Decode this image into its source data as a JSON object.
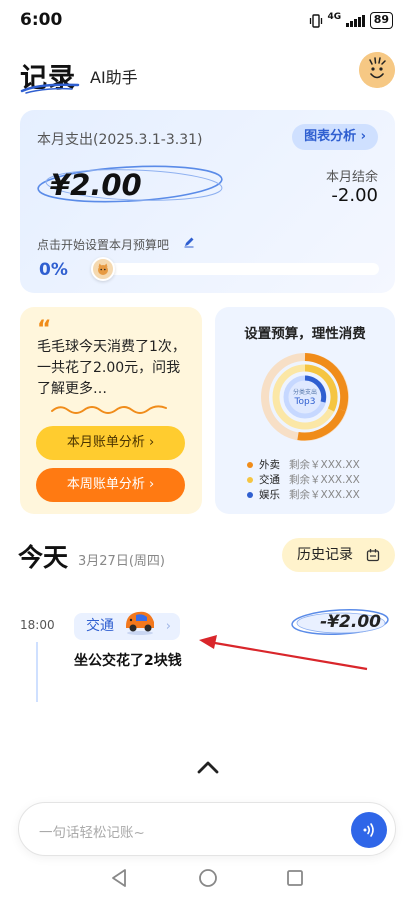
{
  "status": {
    "time": "6:00",
    "network": "4G",
    "battery": "89"
  },
  "header": {
    "tab_records": "记录",
    "tab_ai": "AI助手"
  },
  "summary": {
    "title": "本月支出(2025.3.1-3.31)",
    "chart_button": "图表分析 ›",
    "amount": "¥2.00",
    "balance_label": "本月结余",
    "balance_value": "-2.00",
    "budget_hint": "点击开始设置本月预算吧",
    "budget_percent": "0%",
    "budget_progress": 0
  },
  "mascot": {
    "quote": "“",
    "message": "毛毛球今天消费了1次，一共花了2.00元，问我了解更多…",
    "month_button": "本月账单分析 ›",
    "week_button": "本周账单分析 ›"
  },
  "budget": {
    "title": "设置预算，理性消费",
    "donut_label": "分类支出",
    "donut_center": "Top3",
    "legend": [
      {
        "name": "外卖",
        "rest": "剩余￥XXX.XX",
        "color": "#f08c1a"
      },
      {
        "name": "交通",
        "rest": "剩余￥XXX.XX",
        "color": "#f5c542"
      },
      {
        "name": "娱乐",
        "rest": "剩余￥XXX.XX",
        "color": "#2f5fd0"
      }
    ]
  },
  "today": {
    "label": "今天",
    "date": "3月27日(周四)",
    "history_button": "历史记录"
  },
  "transaction": {
    "time": "18:00",
    "category": "交通",
    "amount": "-¥2.00",
    "description": "坐公交花了2块钱"
  },
  "input": {
    "placeholder": "一句话轻松记账~"
  },
  "colors": {
    "accent": "#2f66e8",
    "orange": "#ff7a12",
    "yellow": "#ffcc2f",
    "arrow": "#d9262b"
  }
}
